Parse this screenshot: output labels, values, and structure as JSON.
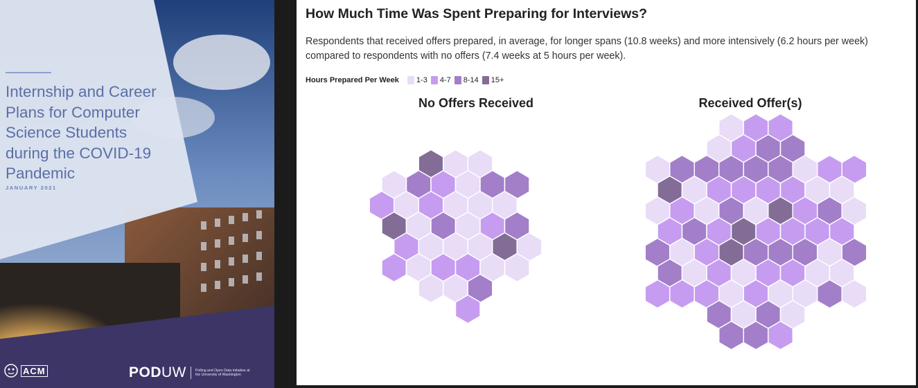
{
  "cover": {
    "title": "Internship and Career Plans for Computer Science Students during the COVID-19 Pandemic",
    "date": "JANUARY 2021",
    "acm_logo": "ACM",
    "acm_subtext": "University of Washington",
    "pod_wordmark_bold": "POD",
    "pod_wordmark_light": "UW",
    "pod_tagline": "Polling and Open Data Initiative at the University of Washington",
    "colors": {
      "title": "#5a6fa6",
      "overlay": "#dde3f0",
      "band": "#3c3566"
    }
  },
  "panel": {
    "heading": "How Much Time Was Spent Preparing for Interviews?",
    "subtitle": "Respondents that received offers prepared, in average, for longer spans (10.8 weeks) and more intensively (6.2 hours per week) compared to respondents with no offers (7.4 weeks at 5 hours per week).",
    "legend": {
      "title": "Hours Prepared Per Week",
      "items": [
        {
          "label": "1-3",
          "color": "#e8dcf7"
        },
        {
          "label": "4-7",
          "color": "#c69cf0"
        },
        {
          "label": "8-14",
          "color": "#a27fc8"
        },
        {
          "label": "15+",
          "color": "#836d97"
        }
      ]
    },
    "charts": [
      {
        "title": "No Offers Received",
        "rows": [
          {
            "offset": 4,
            "cells": [
              3,
              0,
              0
            ]
          },
          {
            "offset": 1,
            "cells": [
              0,
              2,
              1,
              0,
              2,
              2
            ]
          },
          {
            "offset": 0,
            "cells": [
              1,
              0,
              1,
              0,
              0,
              0
            ]
          },
          {
            "offset": 1,
            "cells": [
              3,
              0,
              2,
              0,
              1,
              2
            ]
          },
          {
            "offset": 2,
            "cells": [
              1,
              0,
              0,
              0,
              3,
              0
            ]
          },
          {
            "offset": 1,
            "cells": [
              1,
              0,
              1,
              1,
              0,
              0
            ]
          },
          {
            "offset": 4,
            "cells": [
              0,
              0,
              2
            ]
          },
          {
            "offset": 7,
            "cells": [
              1
            ]
          }
        ]
      },
      {
        "title": "Received Offer(s)",
        "rows": [
          {
            "offset": 6,
            "cells": [
              0,
              1,
              1
            ]
          },
          {
            "offset": 5,
            "cells": [
              0,
              1,
              2,
              2
            ]
          },
          {
            "offset": 0,
            "cells": [
              0,
              2,
              2,
              2,
              2,
              2,
              0,
              1,
              1
            ]
          },
          {
            "offset": 1,
            "cells": [
              3,
              0,
              1,
              1,
              1,
              1,
              0,
              0
            ]
          },
          {
            "offset": 0,
            "cells": [
              0,
              1,
              0,
              2,
              0,
              3,
              1,
              2,
              0
            ]
          },
          {
            "offset": 1,
            "cells": [
              1,
              2,
              1,
              3,
              1,
              1,
              1,
              1
            ]
          },
          {
            "offset": 0,
            "cells": [
              2,
              0,
              1,
              3,
              2,
              2,
              2,
              0,
              2
            ]
          },
          {
            "offset": 1,
            "cells": [
              2,
              0,
              1,
              0,
              1,
              1,
              0,
              0
            ]
          },
          {
            "offset": 0,
            "cells": [
              1,
              1,
              1,
              0,
              1,
              0,
              0,
              2,
              0
            ]
          },
          {
            "offset": 5,
            "cells": [
              2,
              0,
              2,
              0
            ]
          },
          {
            "offset": 6,
            "cells": [
              2,
              2,
              1
            ]
          }
        ]
      }
    ]
  }
}
